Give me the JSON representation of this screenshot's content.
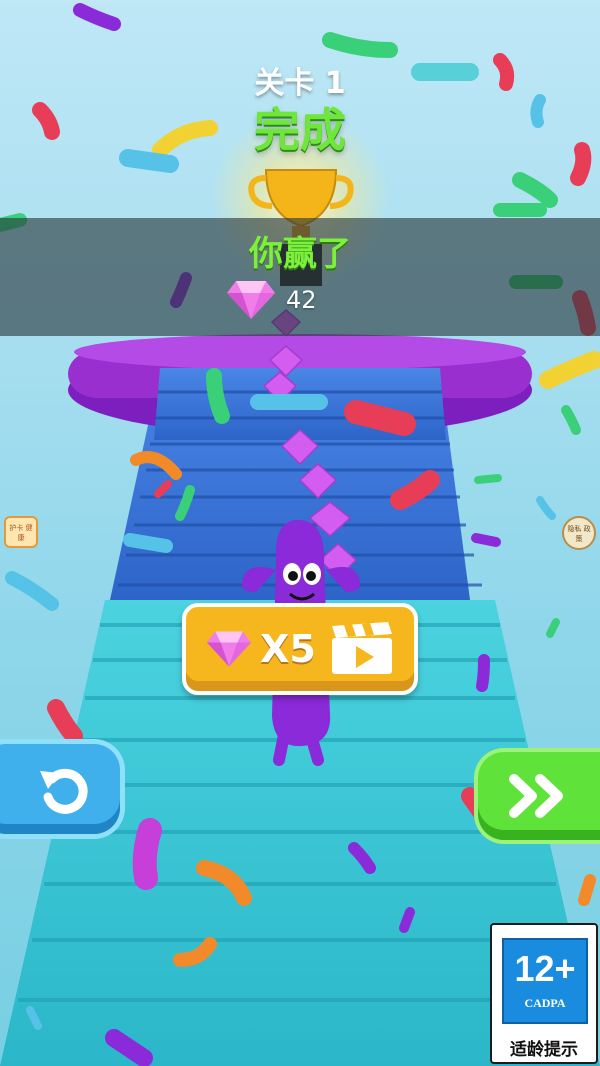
{
  "level": {
    "title": "关卡 1",
    "status": "完成"
  },
  "result": {
    "message": "你赢了"
  },
  "gems": {
    "count": "42",
    "icon": "pink-gem-icon"
  },
  "reward_button": {
    "label": "X5",
    "video_icon": "clapperboard-icon",
    "gem_icon": "pink-gem-icon"
  },
  "controls": {
    "restart_icon": "restart-arrow-icon",
    "next_icon": "double-chevron-right-icon"
  },
  "side_badges": {
    "left_text": "护卡 健康",
    "right_text": "隐私 政策"
  },
  "age_rating": {
    "age": "12+",
    "org": "CADPA",
    "note": "适龄提示"
  },
  "colors": {
    "sky": "#a8dff0",
    "stairs_blue": "#3a78dc",
    "stairs_cyan": "#3fcbd8",
    "platform": "#9a2fd0",
    "gold_button": "#f5b71d",
    "restart": "#3fb0ec",
    "next": "#5fe33b",
    "win_green": "#7cf03c"
  }
}
